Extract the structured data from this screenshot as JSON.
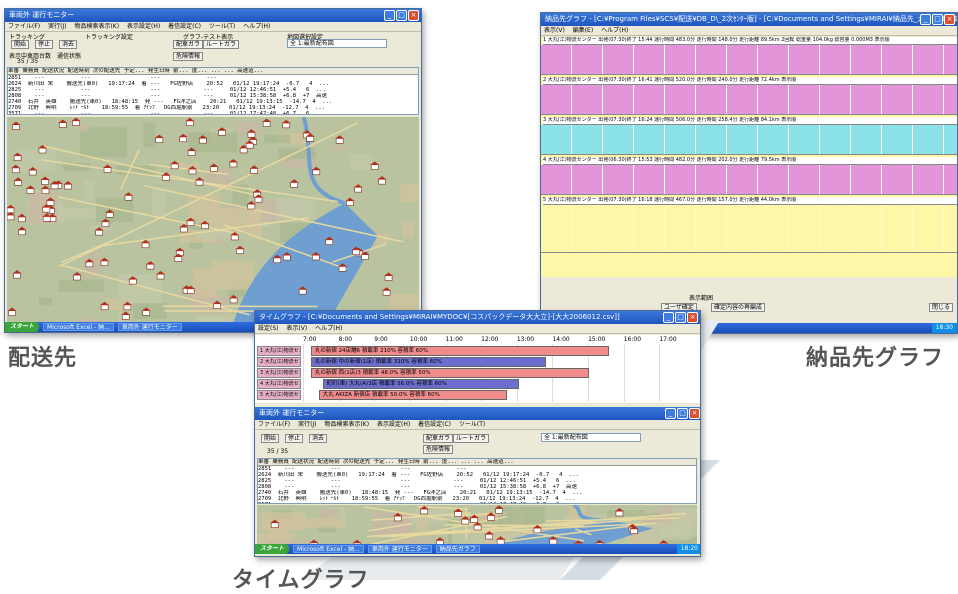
{
  "captions": {
    "left": "配送先",
    "right": "納品先グラフ",
    "bottom": "タイムグラフ"
  },
  "colors": {
    "title_blue": "#1e55c0",
    "map_bg": "#b9c3a0",
    "water": "#6f9fd0",
    "gantt_pink": "#f08c8c",
    "gantt_blue": "#6d6fd0",
    "yellow_grid": "#fff7a8",
    "cyan_band": "#7fe0f0",
    "magenta_band": "#e08ae0"
  },
  "left_window": {
    "title": "車両外 運行モニター",
    "menu": [
      "ファイル(F)",
      "実行(J)",
      "物品検索表示(K)",
      "表示設定(H)",
      "着信設定(C)",
      "ツール(T)",
      "ヘルプ(H)"
    ],
    "controls": {
      "group_label": "トラッキング",
      "buttons": [
        "開始",
        "停止",
        "消去"
      ],
      "button_map": "配車ガラ",
      "button_route": "ルートガラ",
      "button_danger": "危険情報",
      "time_label": "トラッキング設定",
      "graph_label": "グラフ-テスト表示",
      "region_label": "地図選択設定",
      "region_value": "全 1:最新配布図",
      "count_label": "表示中車両台数",
      "count_value": "35 / 35",
      "status_label": "通信状態"
    },
    "columns": [
      "車番",
      "乗務員",
      "配送状況",
      "配送時刻",
      "次の配送先",
      "予定...",
      "発生日時",
      "前...",
      "度...",
      "...",
      "...",
      "高速道..."
    ],
    "rows": [
      "2851    ---           ---                  ---              ---",
      "2624  新川田 栄    搬送先(車0)   19:17:24  着 ---   FG佐野店    20:52   01/12 19:17:24  -0.7   4  ...",
      "2825    ---           ---                  ---             ---     01/12 12:46:51  +5.4   6  ...",
      "2808    ---           ---                  ---             ---     01/12 15:38:58  +6.8  +7  高速",
      "2740  石井  英雄    搬送先(車0)   18:48:15  発 ---   FG洋之店    20:21   01/12 19:13:15  -14.7  4  ...",
      "2709  北野  典明    ﾚｯﾄﾞｰﾙﾄﾞ   18:59:55  着 ｱｲﾗﾌﾞ  DG西堀駅前   23:20   01/12 19:13:24  -12.7  4  ...",
      "3571    ---           ---                  ---             ---     01/12 17:47:48  +6.7   6  ..."
    ],
    "taskbar": {
      "start": "スタート",
      "items": [
        "Microsoft Excel - 納...",
        "車両外 運行モニター"
      ],
      "tray": "18:20"
    }
  },
  "right_window": {
    "title": "納品先グラフ - [C:¥Program Files¥SCS¥配送¥DB_D\\_2次ｾﾝﾀｰ版] - [C:¥Documents and Settings¥MIRAI¥納品先_大大2006012.csv]",
    "menu": [
      "表示(V)",
      "編集(E)",
      "ヘルプ(H)"
    ],
    "bands": [
      "1 大丸(江)物流センター  出発(07:30)終了 15:44  運行時間 483.0分  走行時間 148.0分  走行距離 89.5km  2回転  総重量 104.0kg  総容量 0.000M3  表示順",
      "2 大丸(江)物流センター  出発(07:30)終了 16:41  運行時間 520.0分  走行時間 240.0分  走行距離 72.4km  表示順",
      "3 大丸(江)物流センター  出発(07:30)終了 16:24  運行時間 506.0分  走行時間 258.4分  走行距離 84.1km  表示順",
      "4 大丸(江)物流センター  出発(06:30)終了 15:53  運行時間 482.0分  走行時間 202.0分  走行距離 79.5km  表示順",
      "5 大丸(江)物流センター  出発(07:30)終了 16:18  運行時間 467.0分  走行時間 157.0分  走行距離 44.0km  表示順"
    ],
    "footer_label": "表示範囲",
    "footer_btns": [
      "ユーザ確定",
      "確定内容の再編成",
      "閉じる"
    ]
  },
  "bottom_window": {
    "title": "タイムグラフ - [C:¥Documents and Settings¥MIRAI¥MYDOC¥[コスパックデータ大大立]-[大大2006012.csv]]",
    "menu": [
      "設定(S)",
      "表示(V)",
      "ヘルプ(H)"
    ],
    "time_ticks": [
      "7:00",
      "8:00",
      "9:00",
      "10:00",
      "11:00",
      "12:00",
      "13:00",
      "14:00",
      "15:00",
      "16:00",
      "17:00"
    ],
    "rows": [
      {
        "label": "1 大丸(江)物流センター1",
        "bar": "丸の新宿 24店舗6  積載率 210% 容積率 60%"
      },
      {
        "label": "2 大丸(江)物流センター2",
        "bar": "丸の新宿 中の新宿(1店)  積載率 310% 容積率 60%"
      },
      {
        "label": "3 大丸(江)物流センター3",
        "bar": "丸の新宿 西(1店)3  積載率 48.0% 容積率 50%"
      },
      {
        "label": "4 大丸(江)物流センター4",
        "bar": "町町(車) 大丸(A)3店  積載率 56.0% 容積率 60%"
      },
      {
        "label": "5 大丸(江)物流センター5",
        "bar": "大丸 AKIZA 新宿店  積載率 50.0% 容積率 60%"
      }
    ],
    "inner_title": "車両外 運行モニター",
    "inner_taskbar_items": [
      "Microsoft Excel - 納...",
      "車両外 運行モニター",
      "納品先ガラフ"
    ]
  }
}
